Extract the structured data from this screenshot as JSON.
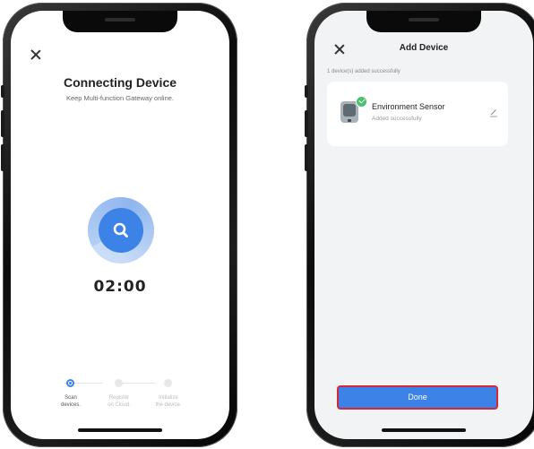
{
  "connecting_screen": {
    "title": "Connecting Device",
    "subtitle": "Keep Multi-function Gateway online.",
    "timer": "02:00",
    "steps": [
      {
        "line1": "Scan",
        "line2": "devices.",
        "active": true
      },
      {
        "line1": "Register",
        "line2": "on Cloud.",
        "active": false
      },
      {
        "line1": "Initialize",
        "line2": "the device.",
        "active": false
      }
    ]
  },
  "add_device_screen": {
    "title": "Add Device",
    "added_count": "1 device(s) added successfully",
    "device": {
      "name": "Environment Sensor",
      "status": "Added successfully"
    },
    "done_label": "Done"
  },
  "colors": {
    "accent": "#3d82e6",
    "success": "#4cc16b",
    "highlight_border": "#d3283c"
  }
}
